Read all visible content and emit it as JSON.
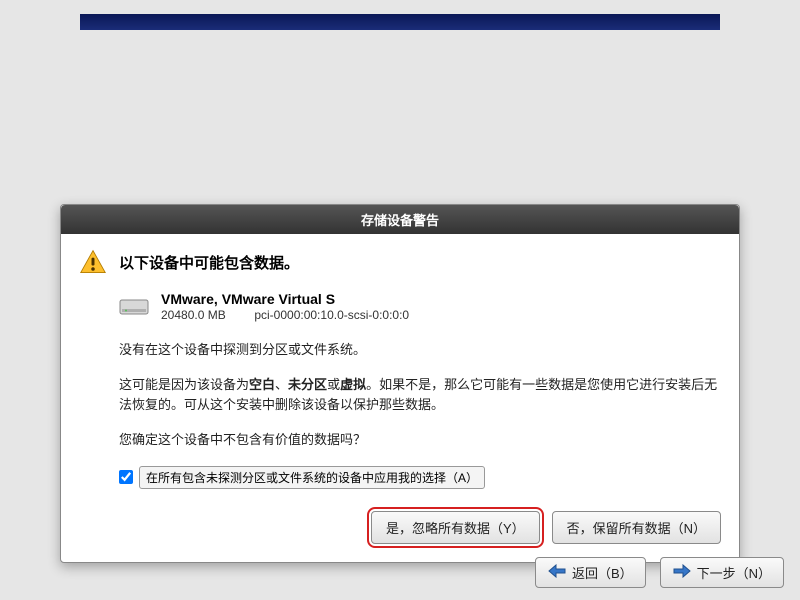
{
  "dialog": {
    "title": "存储设备警告",
    "heading": "以下设备中可能包含数据。",
    "device": {
      "name": "VMware, VMware Virtual S",
      "size": "20480.0 MB",
      "path": "pci-0000:00:10.0-scsi-0:0:0:0"
    },
    "para1": "没有在这个设备中探测到分区或文件系统。",
    "para2a": "这可能是因为该设备为",
    "bold_blank": "空白",
    "sep1": "、",
    "bold_unpart": "未分区",
    "sep2": "或",
    "bold_virtual": "虚拟",
    "para2b": "。如果不是，那么它可能有一些数据是您使用它进行安装后无法恢复的。可从这个安装中删除该设备以保护那些数据。",
    "para3": "您确定这个设备中不包含有价值的数据吗？",
    "checkbox_label": "在所有包含未探测分区或文件系统的设备中应用我的选择（A）",
    "btn_yes": "是，忽略所有数据（Y）",
    "btn_no": "否，保留所有数据（N）"
  },
  "footer": {
    "back": "返回（B）",
    "next": "下一步（N）"
  }
}
